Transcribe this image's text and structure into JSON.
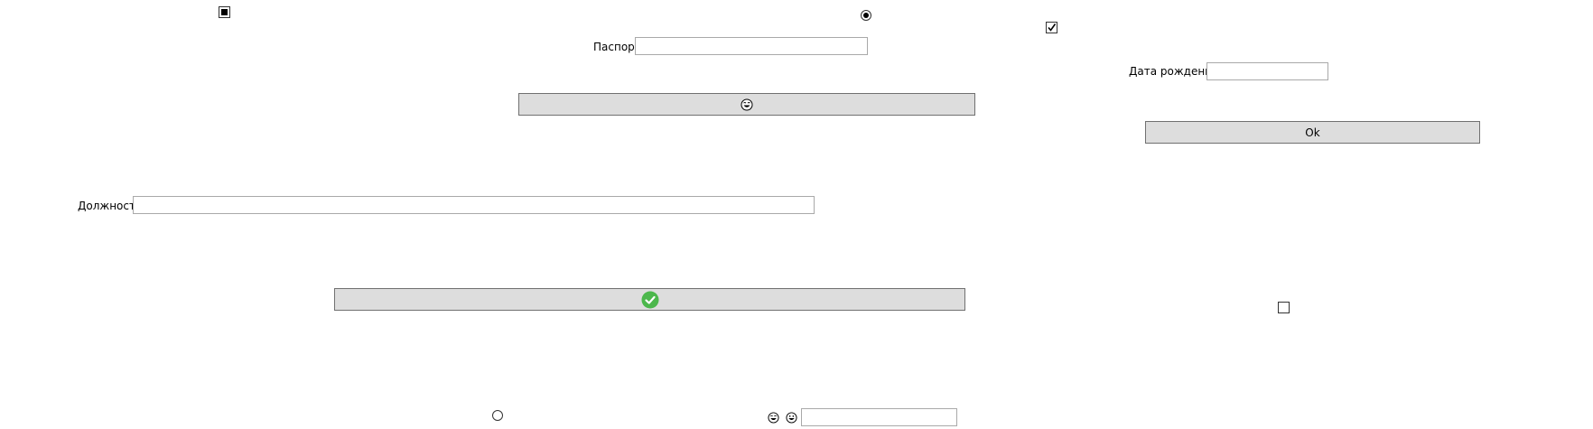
{
  "fields": {
    "passport_label": "Паспорт",
    "birthdate_label": "Дата рождения",
    "position_label": "Должность"
  },
  "buttons": {
    "ok_label": "Ok"
  },
  "controls": {
    "checkbox_top_left_state": "indeterminate",
    "radio_top_center_state": "selected",
    "checkbox_top_right_state": "checked",
    "checkbox_bottom_right_state": "unchecked",
    "radio_bottom_center_state": "unselected"
  },
  "icons": {
    "emoji_button": "laughing-face-icon",
    "confirm_button": "green-check-circle-icon",
    "bottom_emoji_1": "laughing-face-icon",
    "bottom_emoji_2": "grinning-face-icon"
  },
  "colors": {
    "button_bg": "#dddddd",
    "button_border": "#707070",
    "input_border": "#a9a9a9",
    "check_green": "#4cb74c"
  }
}
